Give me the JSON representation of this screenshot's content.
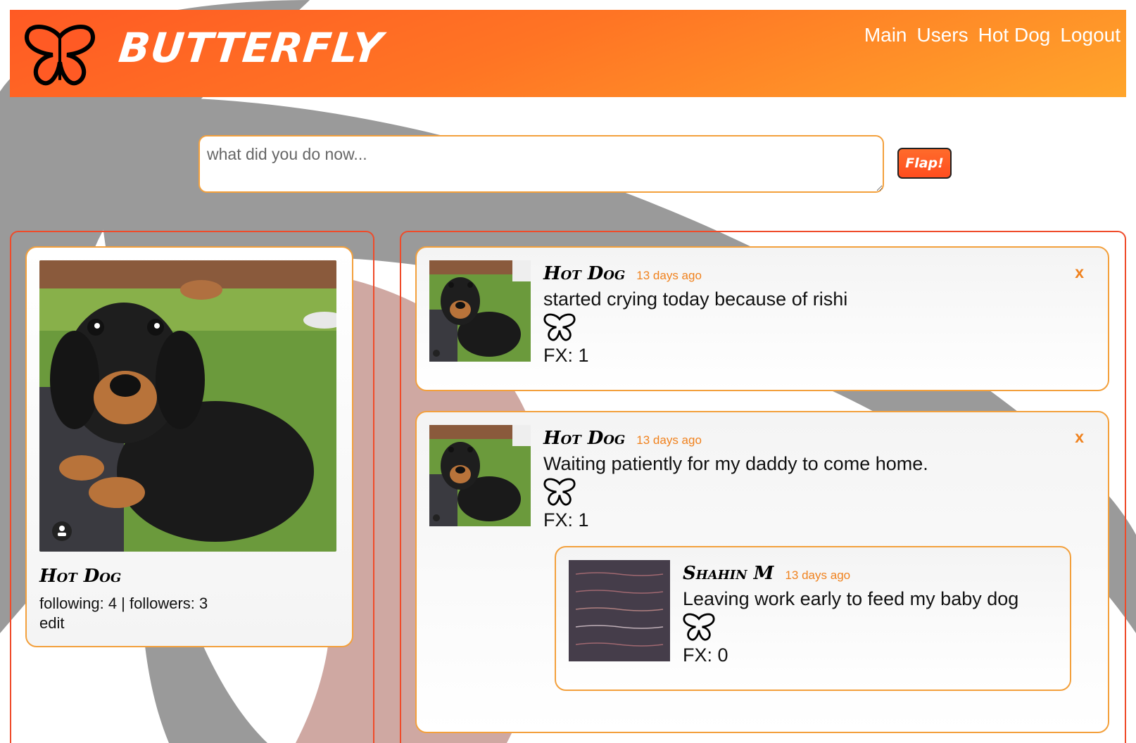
{
  "header": {
    "brand": "BUTTERFLY",
    "nav": [
      "Main",
      "Users",
      "Hot Dog",
      "Logout"
    ]
  },
  "composer": {
    "placeholder": "what did you do now...",
    "button_label": "Flap!"
  },
  "profile": {
    "name": "Hot Dog",
    "stats": "following: 4 | followers: 3",
    "edit_label": "edit"
  },
  "posts": [
    {
      "author": "Hot Dog",
      "time": "13 days ago",
      "text": "started crying today because of rishi",
      "fx": "FX: 1",
      "close": "x"
    },
    {
      "author": "Hot Dog",
      "time": "13 days ago",
      "text": "Waiting patiently for my daddy to come home.",
      "fx": "FX: 1",
      "close": "x",
      "reply": {
        "author": "Shahin M",
        "time": "13 days ago",
        "text": "Leaving work early to feed my baby dog",
        "fx": "FX: 0"
      }
    }
  ],
  "colors": {
    "accent_orange": "#f0821e",
    "header_start": "#ff5a24",
    "header_end": "#ffa52b",
    "panel_border": "#ef4b2a",
    "card_border": "#f3a03c"
  },
  "icons": {
    "logo": "butterfly-icon",
    "like": "butterfly-icon"
  }
}
